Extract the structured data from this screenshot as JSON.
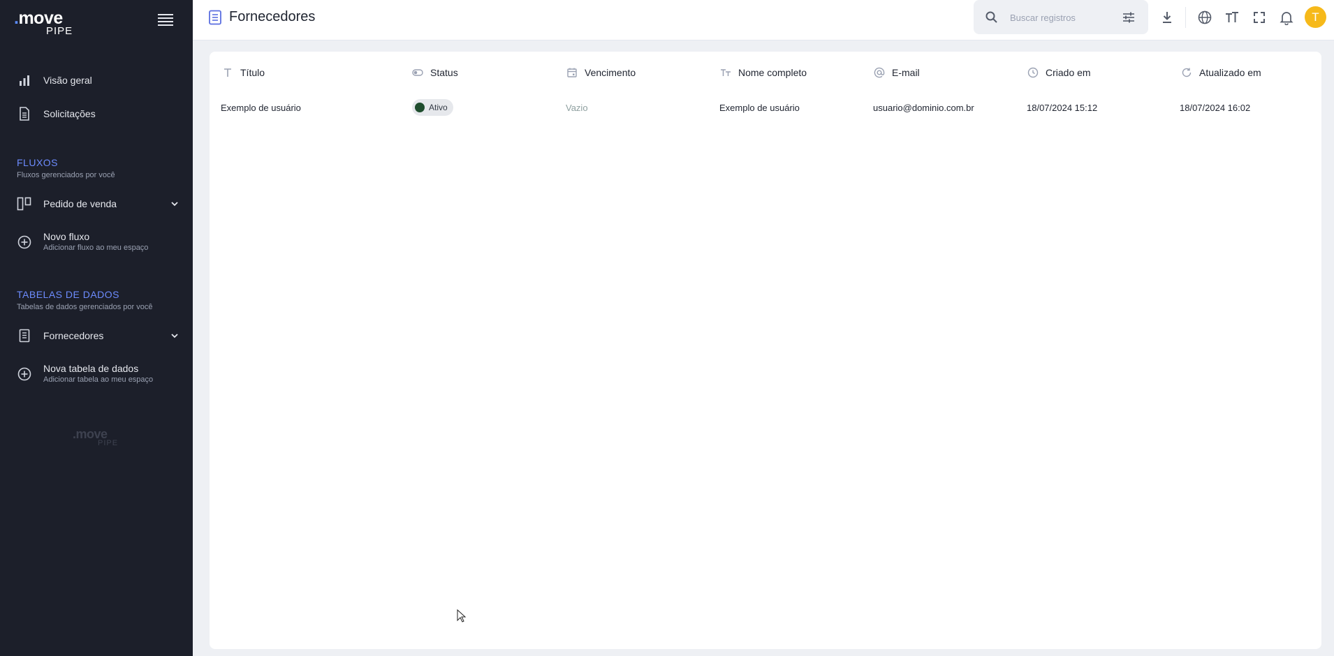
{
  "sidebar": {
    "logo": {
      "word": "move",
      "sub": "PIPE"
    },
    "items": [
      {
        "label": "Visão geral",
        "icon": "bar-chart-icon"
      },
      {
        "label": "Solicitações",
        "icon": "document-icon"
      }
    ],
    "flows_section": {
      "title": "FLUXOS",
      "subtitle": "Fluxos gerenciados por você",
      "items": [
        {
          "label": "Pedido de venda",
          "icon": "kanban-icon"
        },
        {
          "label": "Novo fluxo",
          "sub": "Adicionar fluxo ao meu espaço",
          "icon": "plus-circle-icon"
        }
      ]
    },
    "tables_section": {
      "title": "TABELAS DE DADOS",
      "subtitle": "Tabelas de dados gerenciados por você",
      "items": [
        {
          "label": "Fornecedores",
          "icon": "document-icon"
        },
        {
          "label": "Nova tabela de dados",
          "sub": "Adicionar tabela ao meu espaço",
          "icon": "plus-circle-icon"
        }
      ]
    },
    "footer_logo": {
      "word": "move",
      "sub": "PIPE"
    }
  },
  "header": {
    "title": "Fornecedores",
    "search_placeholder": "Buscar registros",
    "avatar_initial": "T"
  },
  "table": {
    "columns": [
      {
        "label": "Título",
        "icon": "text-icon"
      },
      {
        "label": "Status",
        "icon": "toggle-icon"
      },
      {
        "label": "Vencimento",
        "icon": "calendar-icon"
      },
      {
        "label": "Nome completo",
        "icon": "font-size-icon"
      },
      {
        "label": "E-mail",
        "icon": "at-icon"
      },
      {
        "label": "Criado em",
        "icon": "clock-icon"
      },
      {
        "label": "Atualizado em",
        "icon": "refresh-icon"
      }
    ],
    "rows": [
      {
        "titulo": "Exemplo de usuário",
        "status": "Ativo",
        "vencimento": "Vazio",
        "nome": "Exemplo de usuário",
        "email": "usuario@dominio.com.br",
        "criado": "18/07/2024 15:12",
        "atualizado": "18/07/2024 16:02"
      }
    ]
  },
  "colors": {
    "accent": "#6d8cff",
    "sidebar_bg": "#1c1f2a",
    "avatar": "#f6b91a",
    "status_dot": "#1f4d2e"
  }
}
